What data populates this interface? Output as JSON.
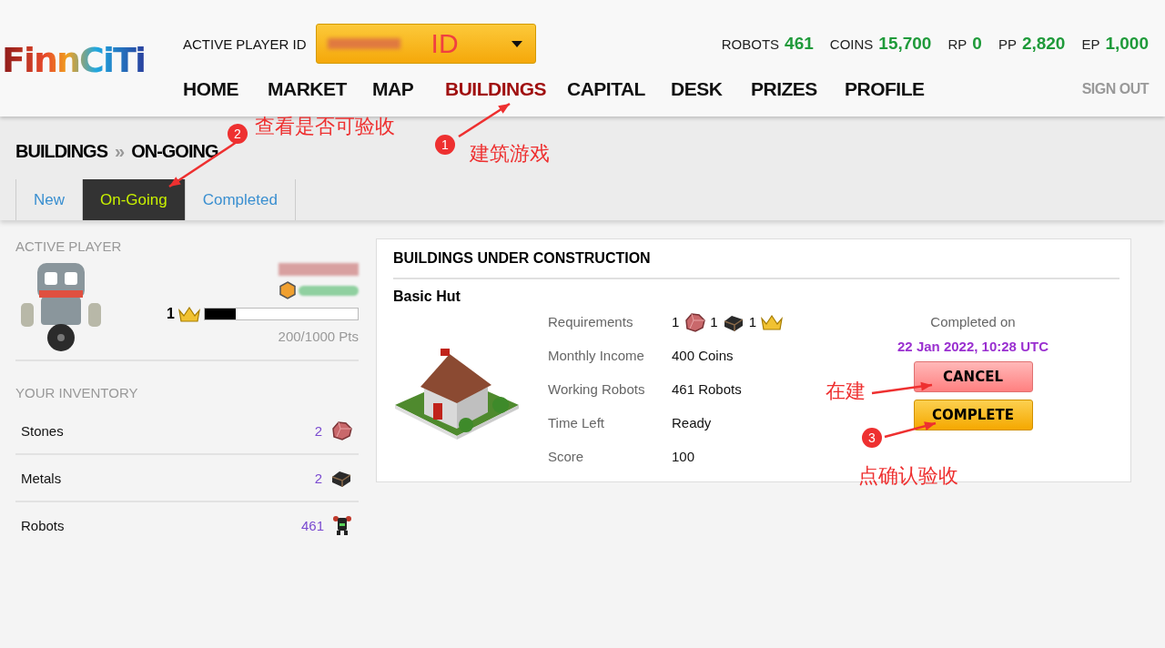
{
  "header": {
    "logo": "FinnCiTi",
    "player_id_label": "ACTIVE PLAYER ID",
    "player_select": {
      "value": "ID"
    },
    "stats": [
      {
        "label": "ROBOTS",
        "value": "461"
      },
      {
        "label": "COINS",
        "value": "15,700"
      },
      {
        "label": "RP",
        "value": "0"
      },
      {
        "label": "PP",
        "value": "2,820"
      },
      {
        "label": "EP",
        "value": "1,000"
      }
    ],
    "nav": [
      {
        "label": "HOME",
        "selected": false
      },
      {
        "label": "MARKET",
        "selected": false
      },
      {
        "label": "MAP",
        "selected": false
      },
      {
        "label": "BUILDINGS",
        "selected": true
      },
      {
        "label": "CAPITAL",
        "selected": false
      },
      {
        "label": "DESK",
        "selected": false
      },
      {
        "label": "PRIZES",
        "selected": false
      },
      {
        "label": "PROFILE",
        "selected": false
      }
    ],
    "sign_out": "SIGN OUT"
  },
  "breadcrumb": {
    "section": "BUILDINGS",
    "separator": "»",
    "page": "ON-GOING"
  },
  "tabs": [
    {
      "label": "New",
      "selected": false
    },
    {
      "label": "On-Going",
      "selected": true
    },
    {
      "label": "Completed",
      "selected": false
    }
  ],
  "sidebar": {
    "active_player_title": "ACTIVE PLAYER",
    "player": {
      "level_number": "1",
      "level": 0.2,
      "points": "200/1000 Pts"
    },
    "inventory_title": "YOUR INVENTORY",
    "inventory": [
      {
        "name": "Stones",
        "count": "2",
        "kind": "stone"
      },
      {
        "name": "Metals",
        "count": "2",
        "kind": "metal"
      },
      {
        "name": "Robots",
        "count": "461",
        "kind": "robot"
      }
    ]
  },
  "construction": {
    "title": "BUILDINGS UNDER CONSTRUCTION",
    "building": "Basic Hut",
    "requirements_label": "Requirements",
    "requirements": [
      {
        "count": "1",
        "kind": "stone"
      },
      {
        "count": "1",
        "kind": "metal"
      },
      {
        "count": "1",
        "kind": "crown"
      }
    ],
    "details": [
      {
        "label": "Monthly Income",
        "value": "400 Coins"
      },
      {
        "label": "Working Robots",
        "value": "461 Robots"
      },
      {
        "label": "Time Left",
        "value": "Ready"
      },
      {
        "label": "Score",
        "value": "100"
      }
    ],
    "completed_label": "Completed on",
    "completed_date": "22 Jan 2022, 10:28 UTC",
    "buttons": [
      {
        "label": "CANCEL",
        "kind": "cancel"
      },
      {
        "label": "COMPLETE",
        "kind": "complete"
      }
    ]
  },
  "annotations": [
    {
      "number": "1",
      "text": "建筑游戏"
    },
    {
      "number": "2",
      "text": "查看是否可验收"
    },
    {
      "text": "在建"
    },
    {
      "number": "3",
      "text": "点确认验收"
    }
  ]
}
